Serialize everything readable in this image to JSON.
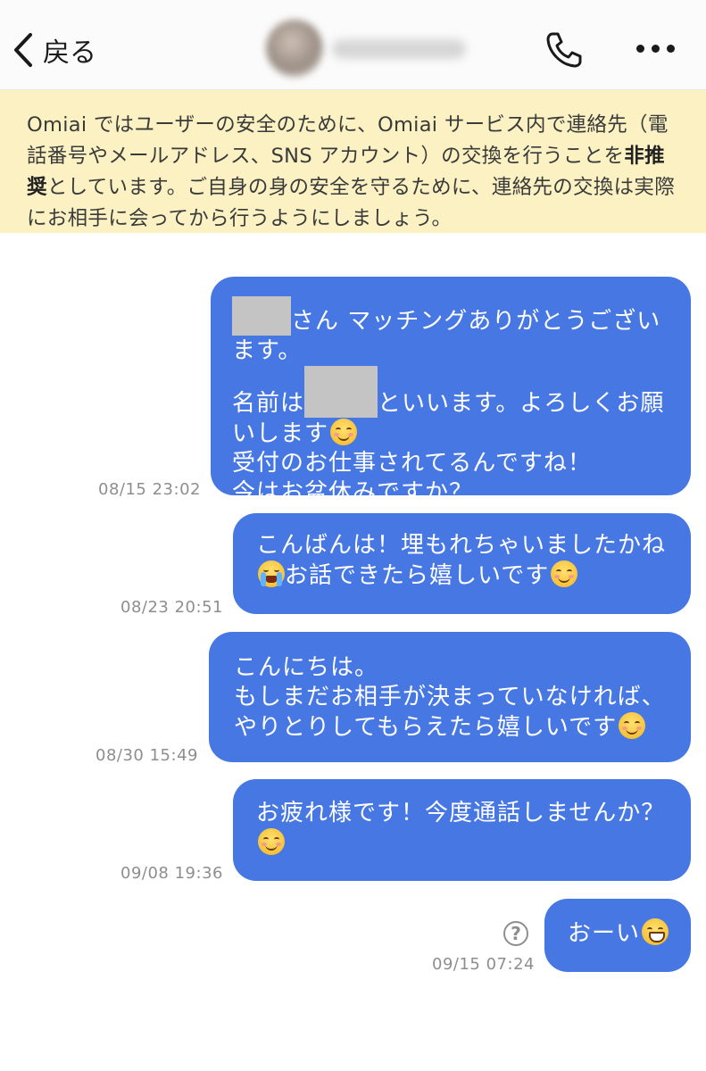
{
  "header": {
    "back_label": "戻る",
    "icons": {
      "back": "chevron-left-icon",
      "call": "phone-icon",
      "menu": "more-horizontal-icon"
    }
  },
  "notice": {
    "text_before": "Omiai ではユーザーの安全のために、Omiai サービス内で連絡先（電話番号やメールアドレス、SNS アカウント）の交換を行うことを",
    "text_bold": "非推奨",
    "text_after": "としています。ご自身の身の安全を守るために、連絡先の交換は実際にお相手に会ってから行うようにしましょう。"
  },
  "messages": [
    {
      "timestamp": "08/15 23:02",
      "line1": "さん マッチングありがとうございます。",
      "line2a": "名前は",
      "line2b": "といいます。よろしくお願いします",
      "line3": "受付のお仕事されてるんですね！",
      "line4": "今はお盆休みですか？"
    },
    {
      "timestamp": "08/23 20:51",
      "line1": "こんばんは！埋もれちゃいましたかね",
      "line2": "お話できたら嬉しいです"
    },
    {
      "timestamp": "08/30 15:49",
      "line1": "こんにちは。",
      "line2": "もしまだお相手が決まっていなければ、",
      "line3": "やりとりしてもらえたら嬉しいです"
    },
    {
      "timestamp": "09/08 19:36",
      "line1": "お疲れ様です！今度通話しませんか？"
    },
    {
      "timestamp": "09/15 07:24",
      "line1": "おーい",
      "status_icon": "question-circle-icon",
      "status_glyph": "?"
    }
  ],
  "colors": {
    "bubble": "#4677e3",
    "notice_bg": "#fbf1c3"
  }
}
